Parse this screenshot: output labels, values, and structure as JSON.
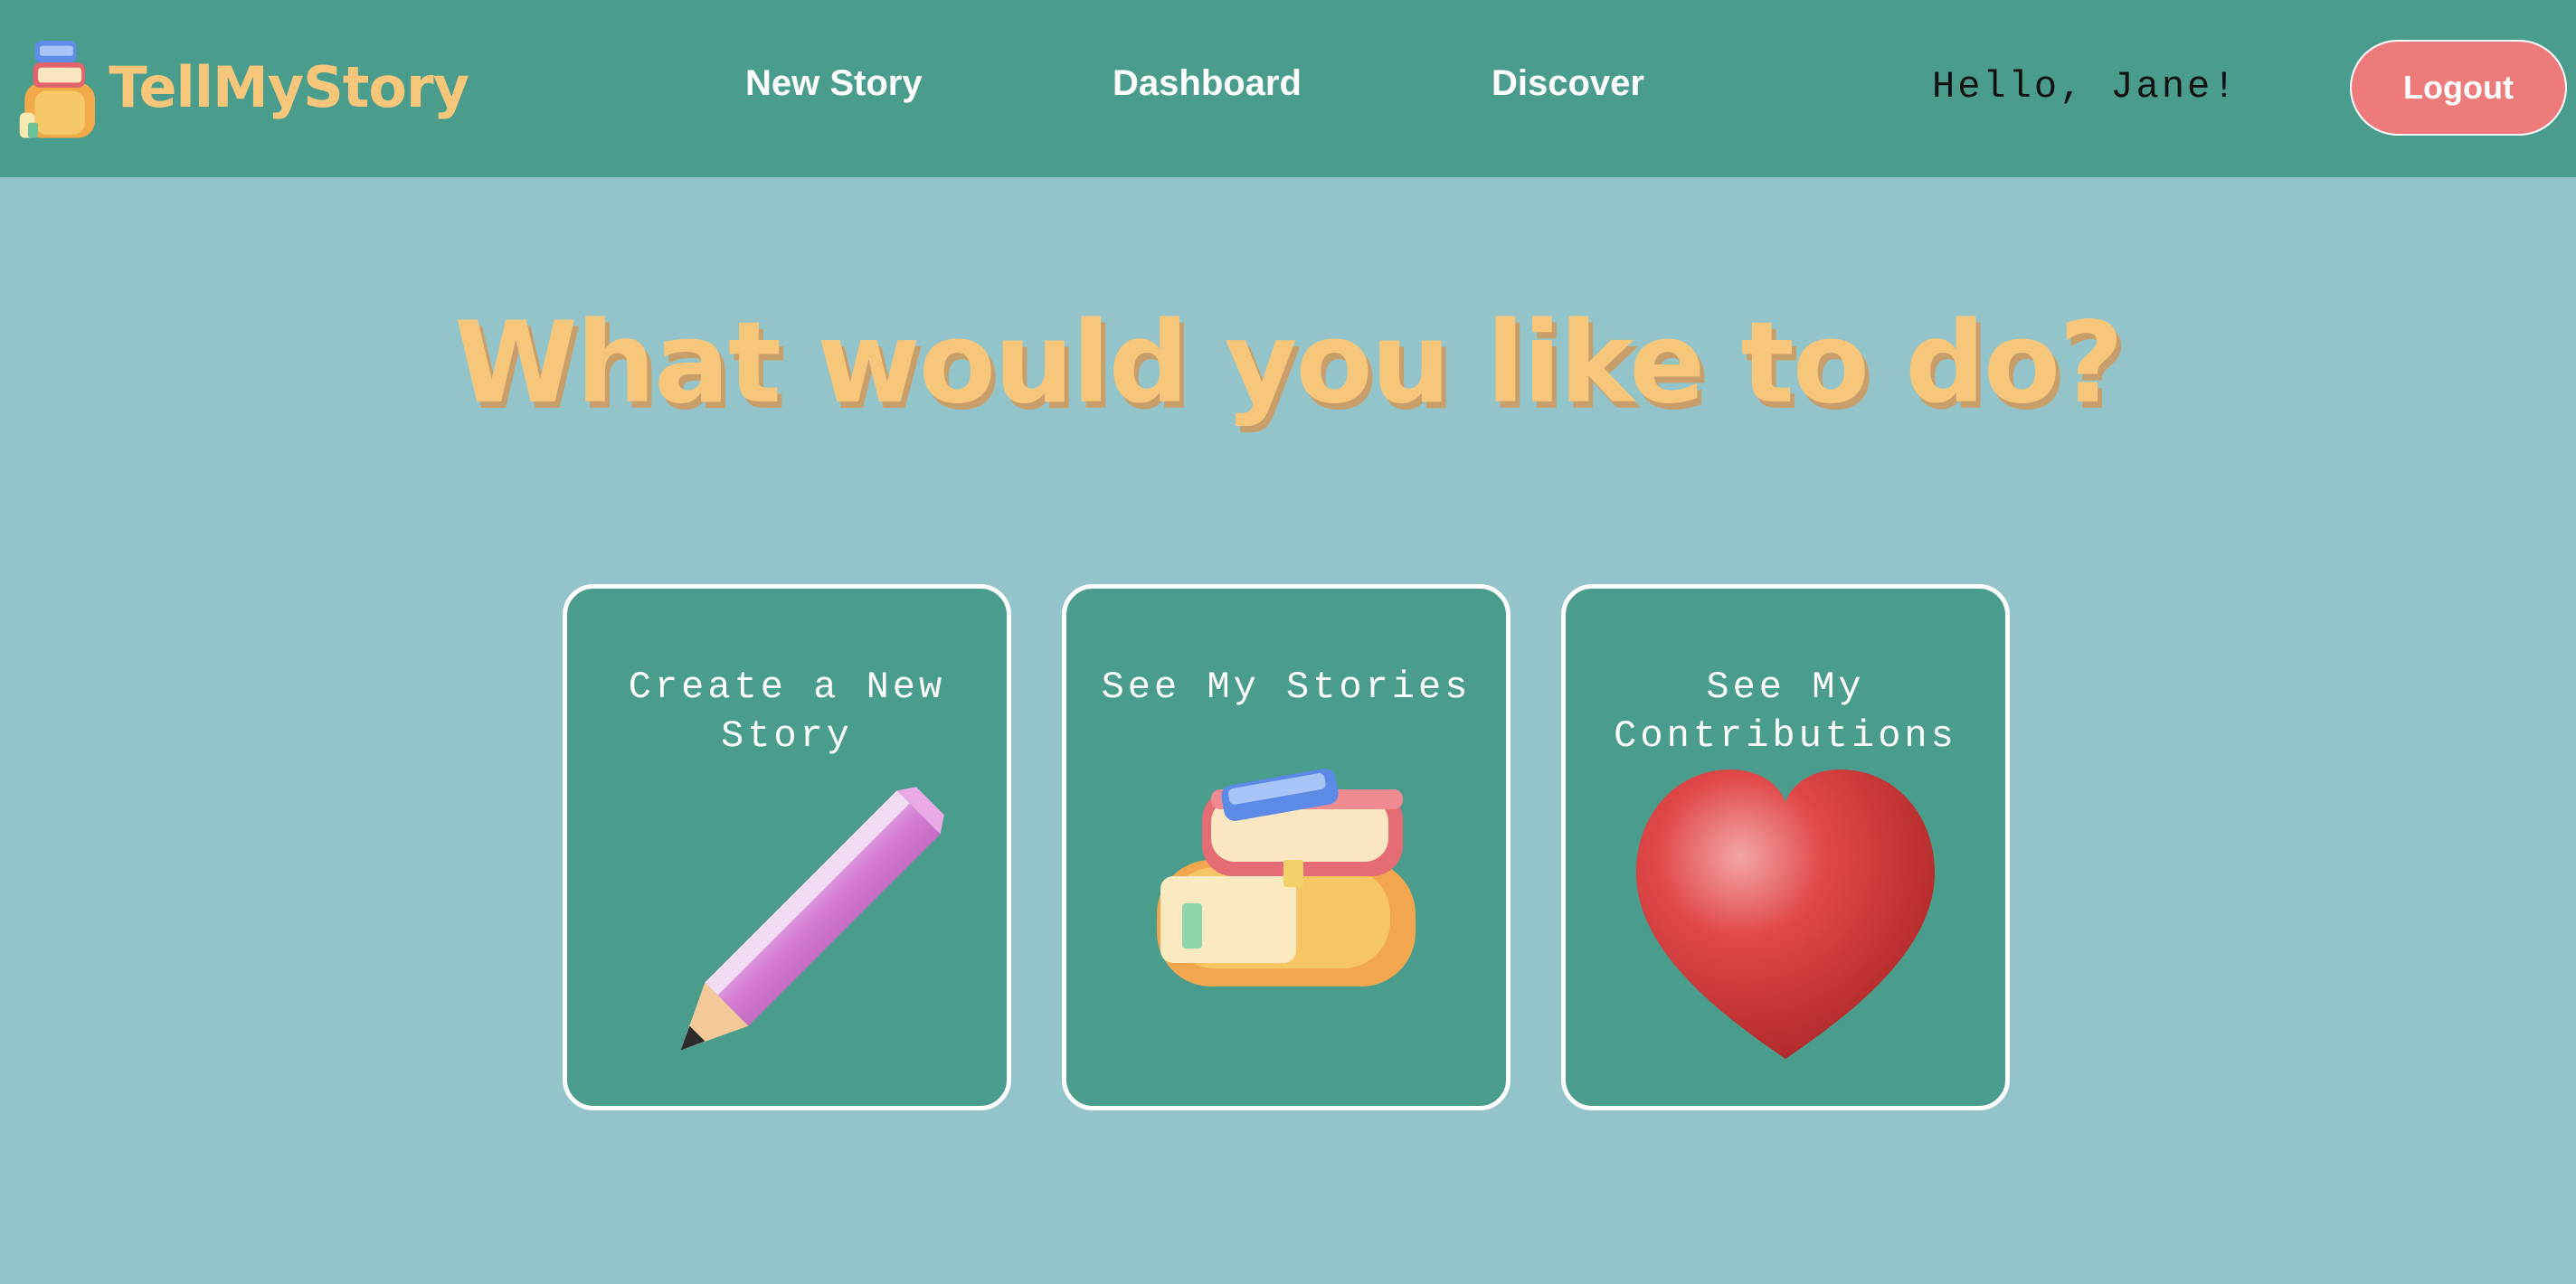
{
  "app": {
    "brand": "TellMyStory"
  },
  "nav": {
    "new_story": "New Story",
    "dashboard": "Dashboard",
    "discover": "Discover"
  },
  "user": {
    "greeting": "Hello, Jane!",
    "logout_label": "Logout"
  },
  "main": {
    "heading": "What would you like to do?",
    "cards": [
      {
        "title": "Create a New Story",
        "icon": "pencil-icon"
      },
      {
        "title": "See My Stories",
        "icon": "books-icon"
      },
      {
        "title": "See My Contributions",
        "icon": "heart-icon"
      }
    ]
  },
  "colors": {
    "nav_bg": "#4a9c8c",
    "page_bg": "#92c4c9",
    "accent": "#f6c67a",
    "logout_bg": "#ee7b7b"
  }
}
